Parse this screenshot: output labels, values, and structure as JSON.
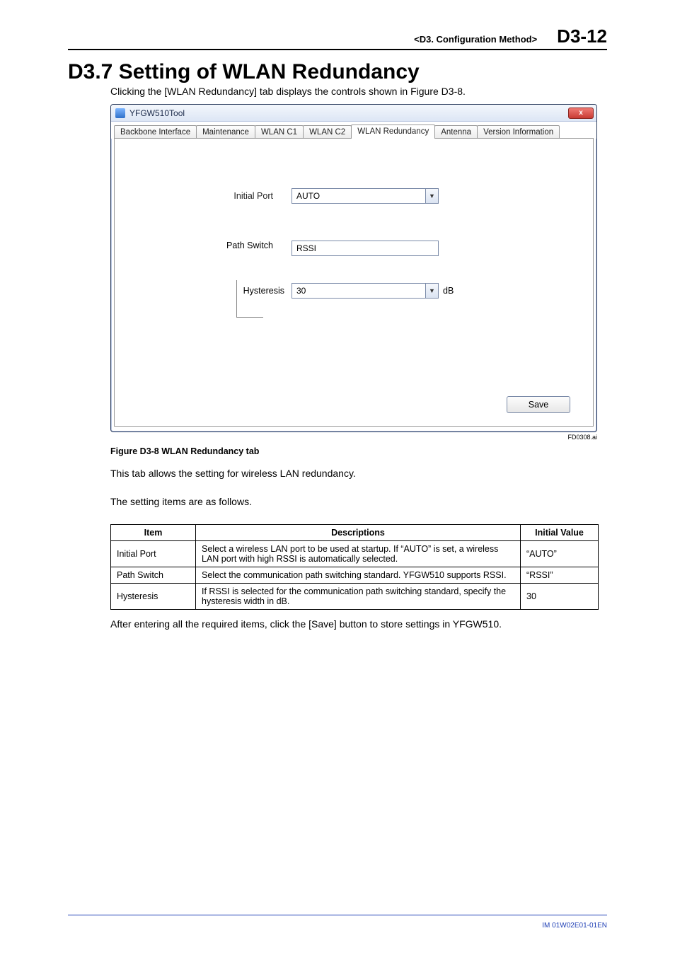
{
  "header": {
    "chapter": "<D3.  Configuration Method>",
    "pagenum": "D3-12"
  },
  "h1": "D3.7    Setting of WLAN Redundancy",
  "intro": "Clicking the [WLAN Redundancy] tab displays the controls shown in Figure D3-8.",
  "window": {
    "title": "YFGW510Tool",
    "close_glyph": "x",
    "tabs": [
      "Backbone Interface",
      "Maintenance",
      "WLAN C1",
      "WLAN C2",
      "WLAN Redundancy",
      "Antenna",
      "Version Information"
    ],
    "initial_port_label": "Initial Port",
    "initial_port_value": "AUTO",
    "path_switch_label": "Path Switch",
    "path_switch_value": "RSSI",
    "hysteresis_label": "Hysteresis",
    "hysteresis_value": "30",
    "hysteresis_unit": "dB",
    "save_label": "Save"
  },
  "figure_id": "FD0308.ai",
  "figure_caption": "Figure D3-8    WLAN Redundancy tab",
  "para1": "This tab allows the setting for wireless LAN redundancy.",
  "para2": "The setting items are as follows.",
  "table": {
    "headers": [
      "Item",
      "Descriptions",
      "Initial Value"
    ],
    "rows": [
      {
        "item": "Initial Port",
        "desc": "Select a wireless LAN port to be used at startup. If “AUTO” is set, a wireless LAN port with high RSSI is automatically selected.",
        "val": "“AUTO”"
      },
      {
        "item": "Path Switch",
        "desc": "Select the communication path switching standard. YFGW510 supports RSSI.",
        "val": "“RSSI”"
      },
      {
        "item": "Hysteresis",
        "desc": "If RSSI is selected for the communication path switching standard, specify the hysteresis width in dB.",
        "val": "30"
      }
    ]
  },
  "para3": "After entering all the required items, click the [Save] button to store settings in YFGW510.",
  "footer": "IM 01W02E01-01EN"
}
